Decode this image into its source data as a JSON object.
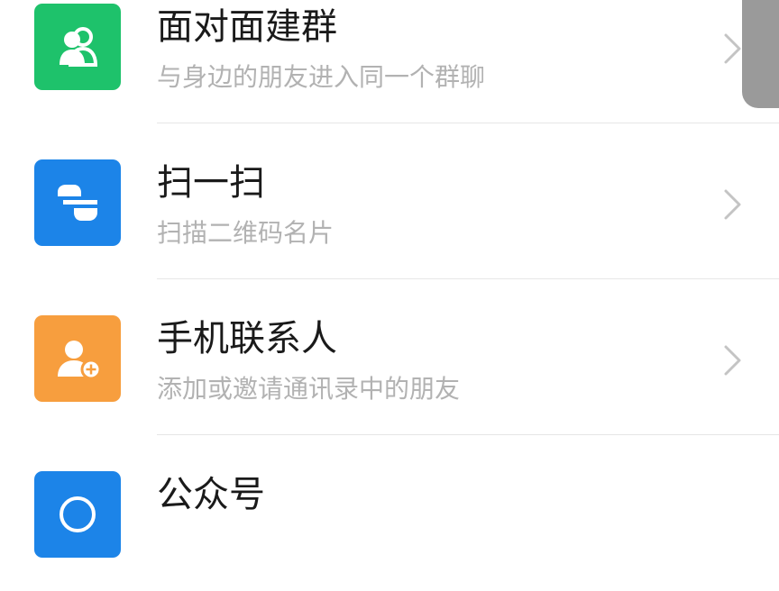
{
  "list": {
    "items": [
      {
        "title": "面对面建群",
        "subtitle": "与身边的朋友进入同一个群聊",
        "icon": "face-to-face-group-icon",
        "color": "#1ec26b"
      },
      {
        "title": "扫一扫",
        "subtitle": "扫描二维码名片",
        "icon": "scan-icon",
        "color": "#1c84e8"
      },
      {
        "title": "手机联系人",
        "subtitle": "添加或邀请通讯录中的朋友",
        "icon": "phone-contacts-icon",
        "color": "#f79e3e"
      },
      {
        "title": "公众号",
        "subtitle": "",
        "icon": "official-accounts-icon",
        "color": "#1c84e8"
      }
    ]
  },
  "chevron_icon": "chevron-right-icon",
  "scrollbar_color": "#9a9a9a"
}
